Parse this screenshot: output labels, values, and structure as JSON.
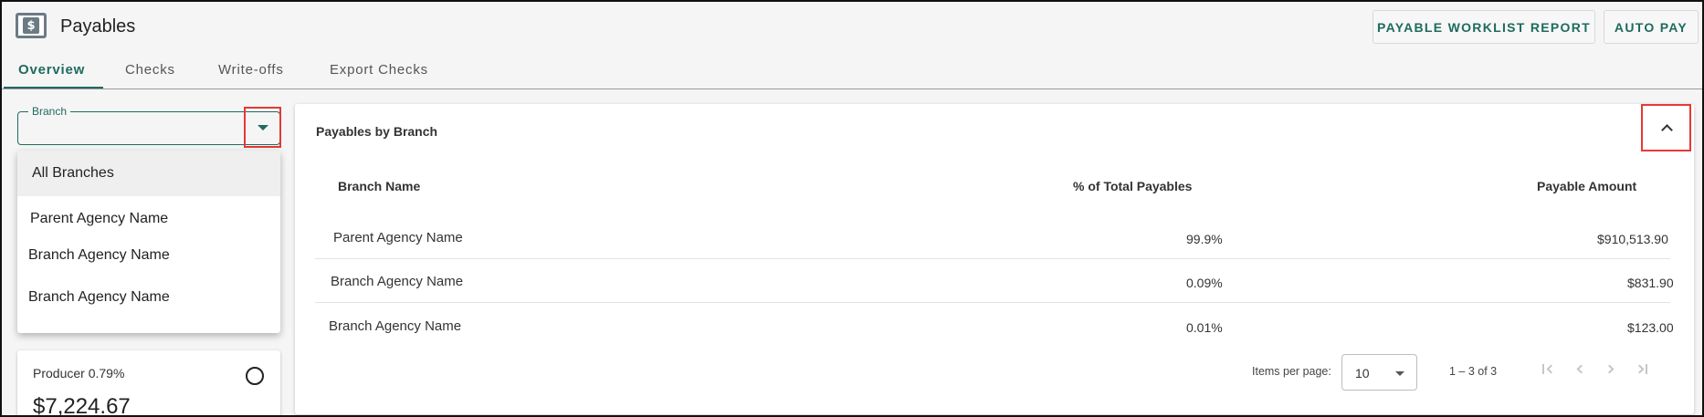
{
  "header": {
    "title": "Payables",
    "icon": "dollar-document-icon",
    "buttons": {
      "worklist": "PAYABLE WORKLIST REPORT",
      "autopay": "AUTO PAY"
    }
  },
  "tabs": [
    {
      "label": "Overview",
      "active": true
    },
    {
      "label": "Checks",
      "active": false
    },
    {
      "label": "Write-offs",
      "active": false
    },
    {
      "label": "Export Checks",
      "active": false
    }
  ],
  "branch_select": {
    "label": "Branch",
    "value": "",
    "options": [
      "All Branches",
      "Parent Agency Name",
      "Branch Agency Name",
      "Branch Agency Name"
    ]
  },
  "producer_card": {
    "label": "Producer 0.79%",
    "amount": "$7,224.67"
  },
  "panel": {
    "title": "Payables by Branch",
    "columns": [
      "Branch Name",
      "% of Total Payables",
      "Payable Amount"
    ],
    "rows": [
      {
        "name": "Parent Agency Name",
        "pct": "99.9%",
        "amount": "$910,513.90"
      },
      {
        "name": "Branch Agency Name",
        "pct": "0.09%",
        "amount": "$831.90"
      },
      {
        "name": "Branch Agency Name",
        "pct": "0.01%",
        "amount": "$123.00"
      }
    ],
    "paginator": {
      "items_per_page_label": "Items per page:",
      "page_size": "10",
      "range": "1 – 3 of 3"
    }
  },
  "colors": {
    "accent": "#1f6b5e",
    "highlight_box": "#e53935"
  }
}
